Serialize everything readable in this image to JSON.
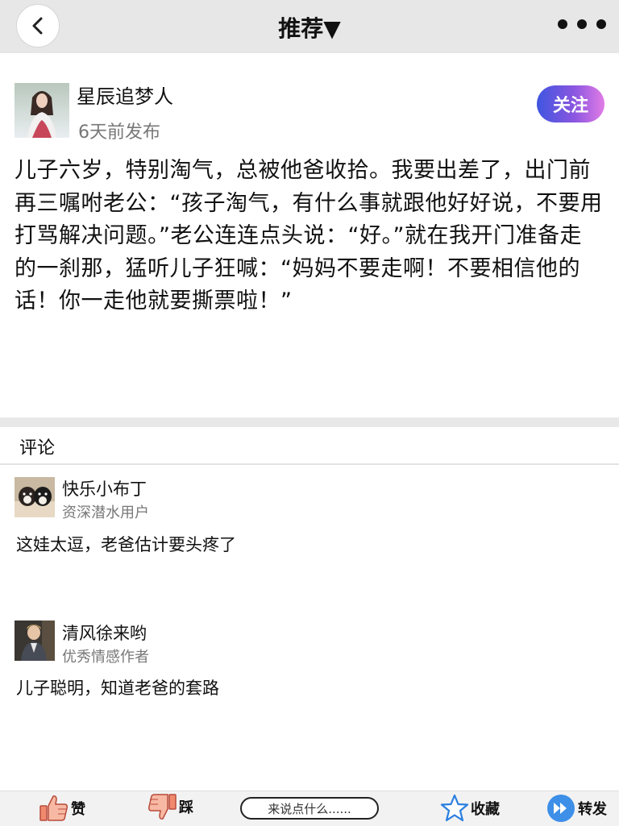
{
  "header": {
    "title": "推荐▼"
  },
  "post": {
    "author_name": "星辰追梦人",
    "time": "6天前发布",
    "follow_label": "关注",
    "content": "儿子六岁，特别淘气，总被他爸收拾。我要出差了，出门前再三嘱咐老公：“孩子淘气，有什么事就跟他好好说，不要用打骂解决问题。”老公连连点头说：“好。”就在我开门准备走的一刹那，猛听儿子狂喊：“妈妈不要走啊！不要相信他的话！你一走他就要撕票啦！”"
  },
  "comments": {
    "title": "评论",
    "items": [
      {
        "name": "快乐小布丁",
        "tag": "资深潜水用户",
        "text": "这娃太逗，老爸估计要头疼了"
      },
      {
        "name": "清风徐来哟",
        "tag": "优秀情感作者",
        "text": "儿子聪明，知道老爸的套路"
      }
    ]
  },
  "bottom_bar": {
    "like_label": "赞",
    "dislike_label": "踩",
    "input_placeholder": "来说点什么......",
    "favorite_label": "收藏",
    "share_label": "转发"
  }
}
